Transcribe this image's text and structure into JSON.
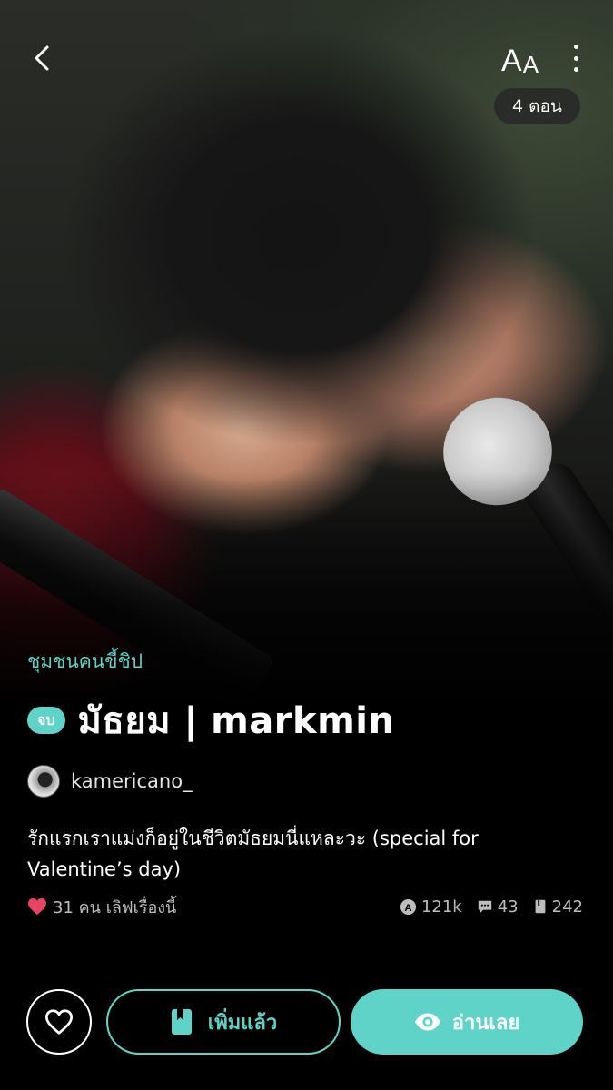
{
  "header": {
    "back_icon": "chevron-left-icon",
    "font_size_label_big": "A",
    "font_size_label_small": "A",
    "more_icon": "more-vertical-icon",
    "chapters": "4 ตอน"
  },
  "cover": {
    "description_icon": "cover-image"
  },
  "story": {
    "category": "ชุมชนคนขี้ชิป",
    "status": "จบ",
    "title": "มัธยม | markmin",
    "author": "kamericano_",
    "synopsis": "รักแรกเราแม่งก็อยู่ในชีวิตมัธยมนี่แหละวะ (special for Valentine’s day)",
    "likes": "31 คน เลิฟเรื่องนี้",
    "views": "121k",
    "comments": "43",
    "bookmarks": "242"
  },
  "actions": {
    "library_label": "เพิ่มแล้ว",
    "read_label": "อ่านเลย"
  },
  "colors": {
    "accent": "#5fd3c8",
    "heart": "#e8435f",
    "background": "#000000"
  }
}
